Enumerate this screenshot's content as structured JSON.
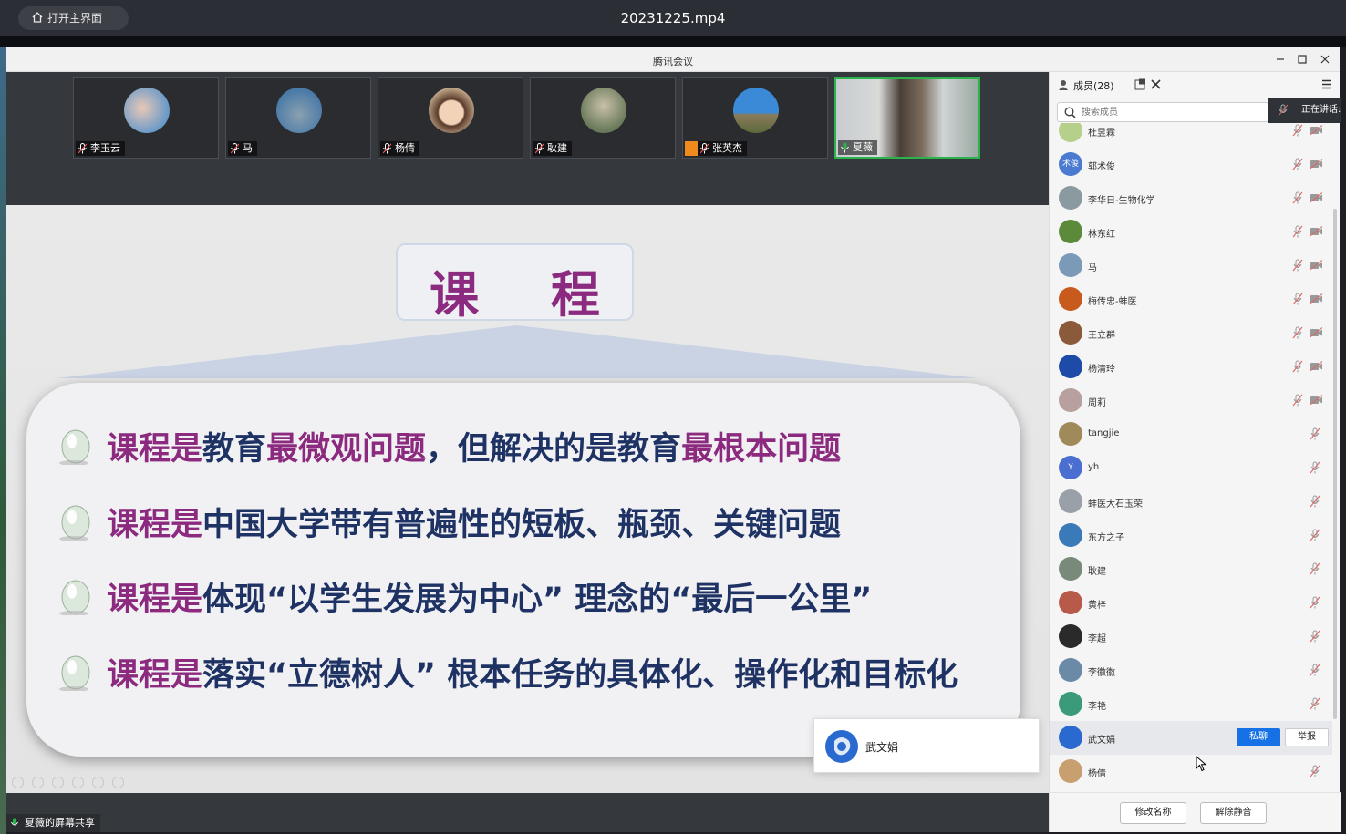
{
  "player": {
    "home_label": "打开主界面",
    "file_title": "20231225.mp4"
  },
  "window": {
    "title": "腾讯会议"
  },
  "video_tiles": [
    {
      "name": "李玉云",
      "mic": "muted"
    },
    {
      "name": "马",
      "mic": "muted"
    },
    {
      "name": "杨倩",
      "mic": "muted"
    },
    {
      "name": "耿建",
      "mic": "muted"
    },
    {
      "name": "张英杰",
      "mic": "muted",
      "host_badge": true
    },
    {
      "name": "夏薇",
      "mic": "active"
    }
  ],
  "slide": {
    "title": "课 程",
    "lines": [
      [
        {
          "t": "课程是",
          "hl": true
        },
        {
          "t": "教育",
          "hl": false
        },
        {
          "t": "最微观问题",
          "hl": true
        },
        {
          "t": "，但解决的是教育",
          "hl": false
        },
        {
          "t": "最根本问题",
          "hl": true
        }
      ],
      [
        {
          "t": "课程是",
          "hl": true
        },
        {
          "t": "中国大学带有普遍性的短板、瓶颈、关键问题",
          "hl": false
        }
      ],
      [
        {
          "t": "课程是",
          "hl": true
        },
        {
          "t": "体现“以学生发展为中心” 理念的“最后一公里”",
          "hl": false
        }
      ],
      [
        {
          "t": "课程是",
          "hl": true
        },
        {
          "t": "落实“立德树人” 根本任务的具体化、操作化和目标化",
          "hl": false
        }
      ]
    ]
  },
  "hover_card": {
    "name": "武文娟"
  },
  "share_badge": "夏薇的屏幕共享",
  "members": {
    "title": "成员(28)",
    "search_placeholder": "搜索成员",
    "speaking_label": "正在讲话:",
    "list": [
      {
        "name": "杜昱霖",
        "color": "#b6cf8a",
        "mic": true,
        "cam": true
      },
      {
        "name": "郭术俊",
        "color": "#4a7bd0",
        "initials": "术俊",
        "mic": true,
        "cam": true
      },
      {
        "name": "李华日-生物化学",
        "color": "#8a9aa0",
        "mic": true,
        "cam": true
      },
      {
        "name": "林东红",
        "color": "#5a8a3a",
        "mic": true,
        "cam": true
      },
      {
        "name": "马",
        "color": "#7a9ab8",
        "mic": true,
        "cam": true
      },
      {
        "name": "梅传忠-蚌医",
        "color": "#c85a1e",
        "mic": true,
        "cam": true
      },
      {
        "name": "王立群",
        "color": "#8a5a3a",
        "mic": true,
        "cam": true
      },
      {
        "name": "杨清玲",
        "color": "#1e4aa8",
        "mic": true,
        "cam": true
      },
      {
        "name": "周莉",
        "color": "#b8a0a0",
        "mic": true,
        "cam": true
      },
      {
        "name": "tangjie",
        "color": "#a08a5a",
        "mic": true,
        "cam": false
      },
      {
        "name": "yh",
        "color": "#4a6fd0",
        "initials": "Y",
        "mic": true,
        "cam": false
      },
      {
        "name": "蚌医大石玉荣",
        "color": "#9aa0a8",
        "mic": true,
        "cam": false
      },
      {
        "name": "东方之子",
        "color": "#3a7ab8",
        "mic": true,
        "cam": false
      },
      {
        "name": "耿建",
        "color": "#7a8a7a",
        "mic": true,
        "cam": false
      },
      {
        "name": "黄梓",
        "color": "#b85a4a",
        "mic": true,
        "cam": false
      },
      {
        "name": "李超",
        "color": "#2a2a2a",
        "mic": true,
        "cam": false
      },
      {
        "name": "李徽徽",
        "color": "#6a8aa8",
        "mic": true,
        "cam": false
      },
      {
        "name": "李艳",
        "color": "#3a9a7a",
        "mic": true,
        "cam": false
      },
      {
        "name": "武文娟",
        "color": "#2a6ad0",
        "mic": false,
        "cam": false,
        "selected": true
      },
      {
        "name": "杨倩",
        "color": "#c8a070",
        "mic": true,
        "cam": false
      }
    ],
    "selected_actions": {
      "chat": "私聊",
      "report": "举报"
    },
    "footer": {
      "rename": "修改名称",
      "unmute": "解除静音"
    }
  },
  "colors": {
    "accent": "#1571e5",
    "slide_highlight": "#8b2a7e",
    "slide_text": "#1e3264",
    "active_speaker": "#2bb34b"
  }
}
